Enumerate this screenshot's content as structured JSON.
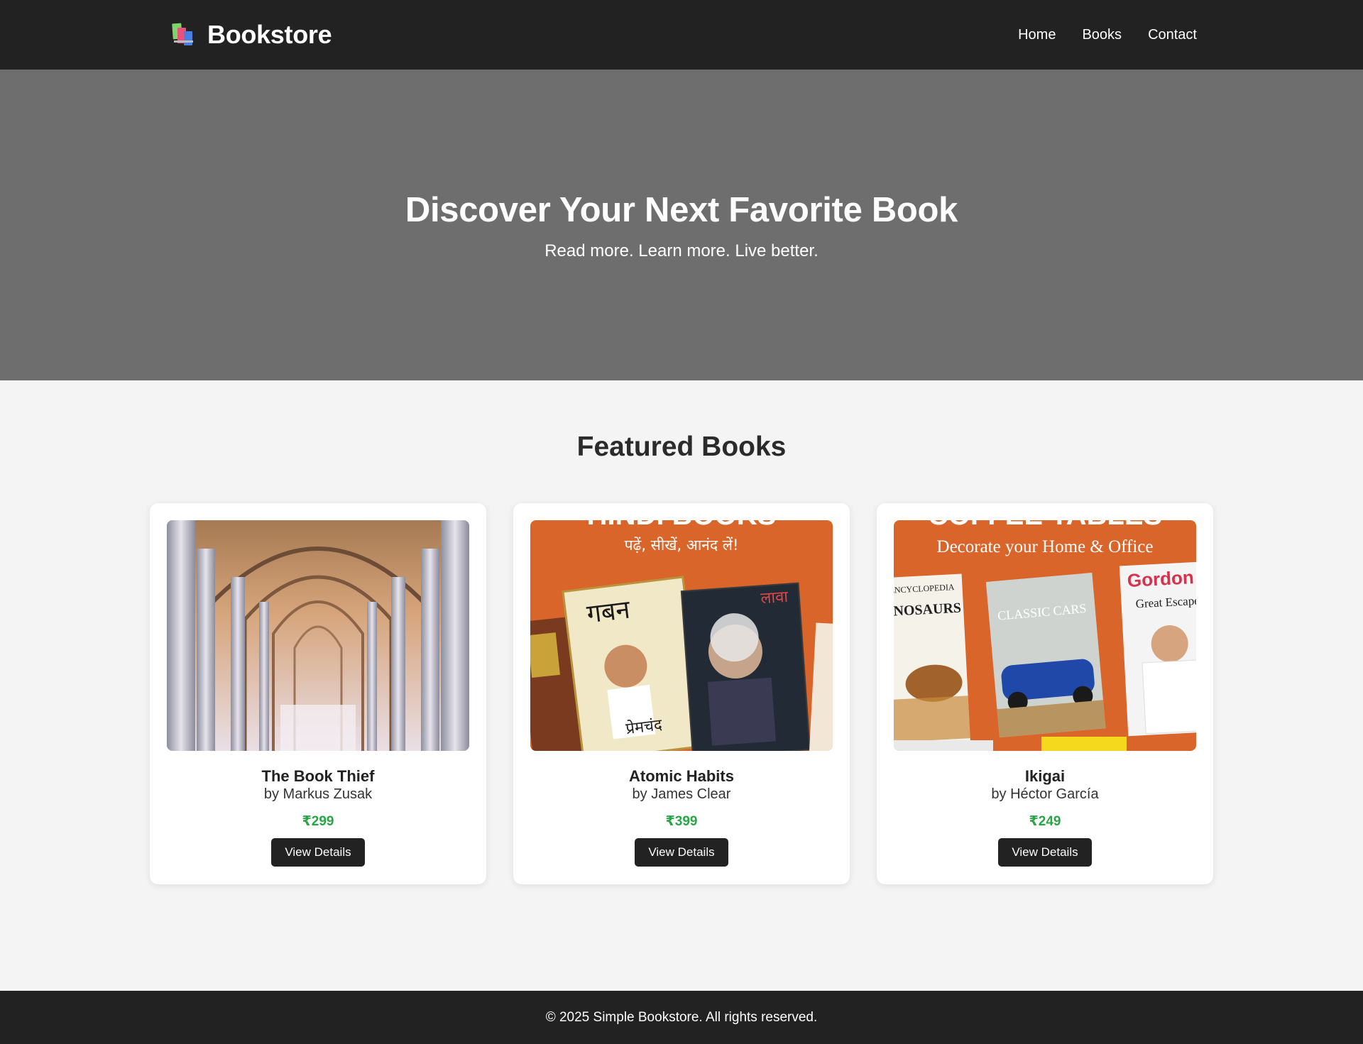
{
  "header": {
    "brand": "Bookstore",
    "logo_icon": "books-icon",
    "nav": [
      {
        "label": "Home"
      },
      {
        "label": "Books"
      },
      {
        "label": "Contact"
      }
    ]
  },
  "hero": {
    "title": "Discover Your Next Favorite Book",
    "subtitle": "Read more. Learn more. Live better."
  },
  "featured": {
    "heading": "Featured Books",
    "books": [
      {
        "title": "The Book Thief",
        "author": "by Markus Zusak",
        "price": "₹299",
        "button": "View Details",
        "cover": {
          "kind": "photo"
        }
      },
      {
        "title": "Atomic Habits",
        "author": "by James Clear",
        "price": "₹399",
        "button": "View Details",
        "cover": {
          "kind": "banner",
          "banner_heading": "HINDI BOOKS",
          "banner_tagline": "पढ़ें, सीखें, आनंद लें!",
          "cover_labels": [
            "गबन",
            "प्रेमचंद",
            "लावा"
          ]
        }
      },
      {
        "title": "Ikigai",
        "author": "by Héctor García",
        "price": "₹249",
        "button": "View Details",
        "cover": {
          "kind": "banner",
          "banner_heading": "COFFEE TABLES",
          "banner_tagline": "Decorate your Home & Office",
          "cover_labels": [
            "ENCYCLOPEDIA",
            "DINOSAURS",
            "CLASSIC CARS",
            "Gordon Ramsay",
            "Great Escapes"
          ]
        }
      }
    ]
  },
  "footer": {
    "text": "© 2025 Simple Bookstore. All rights reserved."
  },
  "colors": {
    "header_bg": "#222222",
    "hero_bg": "#6e6e6e",
    "page_bg": "#f4f4f4",
    "price": "#27a745",
    "button_bg": "#222222",
    "banner_orange": "#d9652b"
  }
}
